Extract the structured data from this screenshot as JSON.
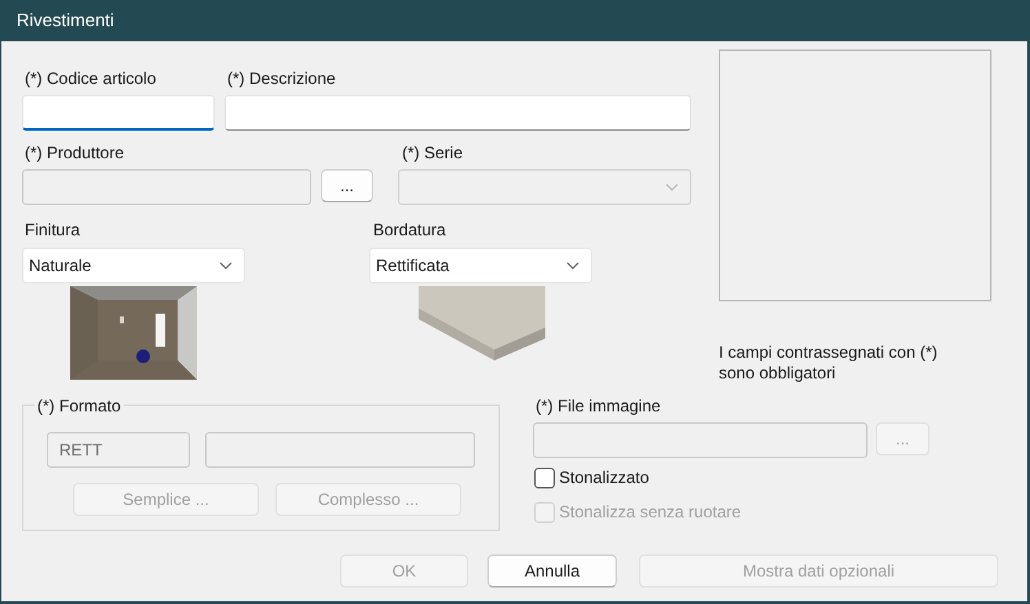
{
  "window": {
    "title": "Rivestimenti"
  },
  "codice_articolo": {
    "label": "(*) Codice articolo",
    "focused": true
  },
  "descrizione": {
    "label": "(*) Descrizione",
    "focused": false
  },
  "produttore": {
    "label": "(*) Produttore",
    "disabled": true,
    "browse_button": {
      "label": "...",
      "disabled": false
    }
  },
  "serie": {
    "label": "(*) Serie",
    "disabled": true
  },
  "finitura": {
    "label": "Finitura",
    "value": "Naturale",
    "disabled": false
  },
  "bordatura": {
    "label": "Bordatura",
    "value": "Rettificata",
    "disabled": false
  },
  "note": "I campi contrassegnati con (*) sono obbligatori",
  "formato": {
    "label": "(*) Formato",
    "code": {
      "value": "RETT",
      "disabled": true
    },
    "description": {
      "disabled": true
    },
    "buttons": [
      {
        "label": "Semplice ...",
        "disabled": true
      },
      {
        "label": "Complesso ...",
        "disabled": true
      }
    ]
  },
  "file_immagine": {
    "label": "(*) File immagine",
    "disabled": true,
    "browse_button": {
      "label": "...",
      "disabled": true
    }
  },
  "checkboxes": [
    {
      "label": "Stonalizzato",
      "checked": false,
      "disabled": false
    },
    {
      "label": "Stonalizza senza ruotare",
      "checked": false,
      "disabled": true
    }
  ],
  "buttons": [
    {
      "label": "OK",
      "disabled": true
    },
    {
      "label": "Annulla",
      "disabled": false
    },
    {
      "label": "Mostra dati opzionali",
      "disabled": true
    }
  ]
}
